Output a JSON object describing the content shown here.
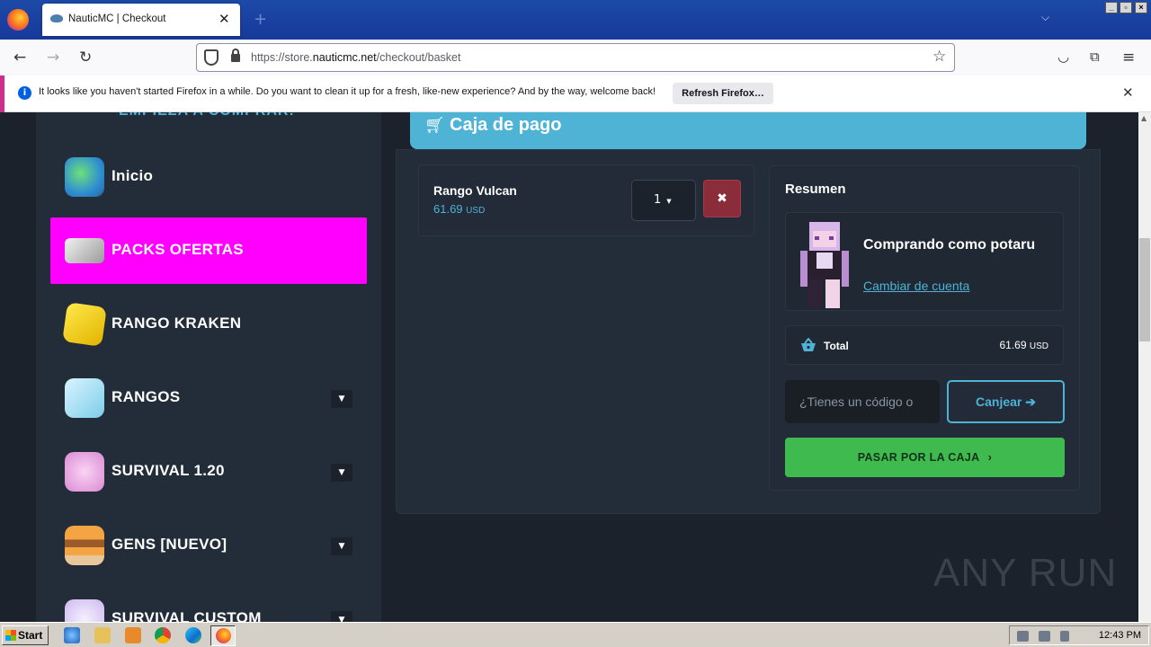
{
  "browser": {
    "tab_title": "NauticMC | Checkout",
    "url_prefix": "https://store.",
    "url_domain": "nauticmc.net",
    "url_path": "/checkout/basket",
    "notification_text": "It looks like you haven't started Firefox in a while. Do you want to clean it up for a fresh, like-new experience? And by the way, welcome back!",
    "notification_button": "Refresh Firefox…"
  },
  "sidebar": {
    "cut_heading": "EMPIEZA A COMPRAR!",
    "items": [
      {
        "label": "Inicio",
        "icon": "globe-icon",
        "active": false,
        "dropdown": false
      },
      {
        "label": "PACKS OFERTAS",
        "icon": "tag-icon",
        "active": true,
        "dropdown": false
      },
      {
        "label": "RANGO KRAKEN",
        "icon": "lucky-block-icon",
        "active": false,
        "dropdown": false
      },
      {
        "label": "RANGOS",
        "icon": "ice-block-icon",
        "active": false,
        "dropdown": true
      },
      {
        "label": "SURVIVAL 1.20",
        "icon": "pink-block-icon",
        "active": false,
        "dropdown": true
      },
      {
        "label": "GENS [NUEVO]",
        "icon": "cake-block-icon",
        "active": false,
        "dropdown": true
      },
      {
        "label": "SURVIVAL CUSTOM",
        "icon": "snow-block-icon",
        "active": false,
        "dropdown": true
      }
    ]
  },
  "checkout": {
    "title": "Caja de pago",
    "item": {
      "name": "Rango Vulcan",
      "price": "61.69",
      "currency": "USD",
      "quantity": "1"
    },
    "summary": {
      "title": "Resumen",
      "buying_as": "Comprando como potaru",
      "change_account": "Cambiar de cuenta",
      "total_label": "Total",
      "total_value": "61.69",
      "total_currency": "USD",
      "coupon_placeholder": "¿Tienes un código o",
      "redeem_button": "Canjear",
      "checkout_button": "PASAR POR LA CAJA"
    }
  },
  "watermark": "ANY RUN",
  "taskbar": {
    "start_label": "Start",
    "clock": "12:43 PM"
  },
  "colors": {
    "accent": "#4fb3d6",
    "active_item": "#ff00ff",
    "checkout_green": "#3fba4e",
    "remove_red": "#8a2c3a"
  }
}
